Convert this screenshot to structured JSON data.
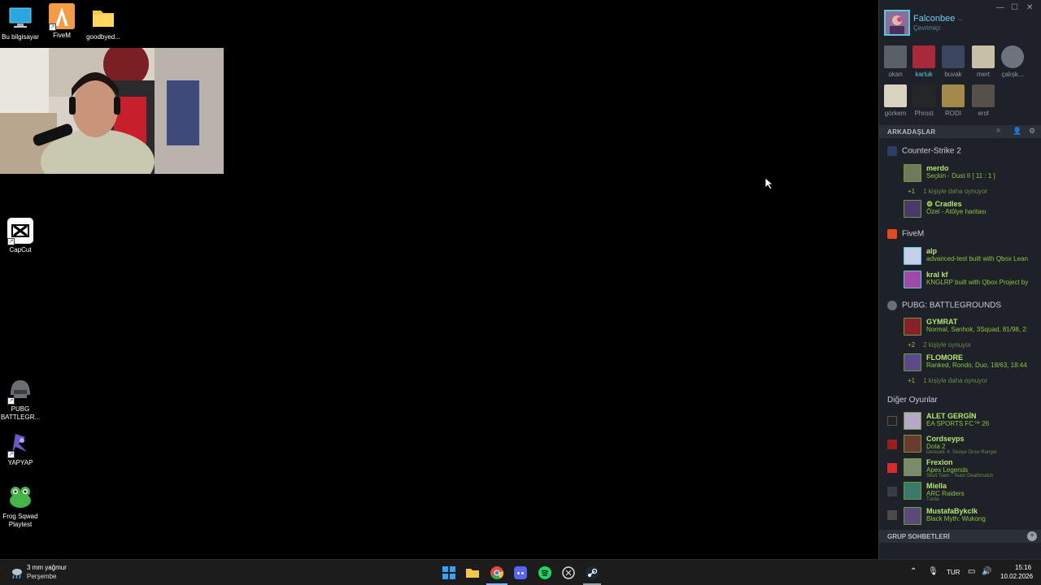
{
  "desktop_icons": {
    "this_pc": "Bu bilgisayar",
    "fivem": "FiveM",
    "folder": "goodbyed...",
    "capcut": "CapCut",
    "pubg_line1": "PUBG",
    "pubg_line2": "BATTLEGR...",
    "yapyap": "YAPYAP",
    "frog_line1": "Frog Sqwad",
    "frog_line2": "Playtest"
  },
  "steam": {
    "user_name": "Falconbee",
    "user_status": "Çevrimiçi",
    "favorites": [
      "okan",
      "karluk",
      "buvak",
      "mert",
      "çalışk...",
      "görkem",
      "Phrost",
      "RODI",
      "erol"
    ],
    "friends_title": "ARKADAŞLAR",
    "group_title": "GRUP SOHBETLERİ",
    "games": {
      "cs2": "Counter-Strike 2",
      "fivem": "FiveM",
      "pubg": "PUBG: BATTLEGROUNDS",
      "other": "Diğer Oyunlar"
    },
    "cs2_friends": [
      {
        "name": "merdo",
        "status": "Seçkin - Dust II [ 11 : 1 ]"
      },
      {
        "name": "Cradles",
        "status": "Özel - Atölye haritası"
      }
    ],
    "cs2_more": {
      "count": "+1",
      "text": "1 kişiyle daha oynuyor"
    },
    "fivem_friends": [
      {
        "name": "alp",
        "status": "advanced-test built with Qbox Lean"
      },
      {
        "name": "kral kf",
        "status": "KNGLRP built with Qbox Project by"
      }
    ],
    "pubg_friends": [
      {
        "name": "GYMRAT",
        "status": "Normal, Sanhok, 3Squad, 81/98, 2:"
      },
      {
        "name": "FLOMORE",
        "status": "Ranked, Rondo, Duo, 18/63, 18:44"
      }
    ],
    "pubg_more1": {
      "count": "+2",
      "text": "2 kişiyle oynuyor"
    },
    "pubg_more2": {
      "count": "+1",
      "text": "1 kişiyle daha oynuyor"
    },
    "other_friends": [
      {
        "name": "ALET GERGİN",
        "status": "EA SPORTS FC™ 26",
        "detail": ""
      },
      {
        "name": "Cordseyps",
        "status": "Dota 2",
        "detail": "Dereceli: 4. Seviye Drow Ranger"
      },
      {
        "name": "Frexion",
        "status": "Apex Legends",
        "detail": "Skull Town - Team Deathmatch"
      },
      {
        "name": "Miella",
        "status": "ARC Raiders",
        "detail": "Turda"
      },
      {
        "name": "MustafaBykclk",
        "status": "Black Myth: Wukong",
        "detail": ""
      }
    ]
  },
  "taskbar": {
    "weather_temp": "3 mm yağmur",
    "weather_day": "Perşembe",
    "lang": "TUR",
    "time": "15:16",
    "date": "10.02.2026"
  }
}
